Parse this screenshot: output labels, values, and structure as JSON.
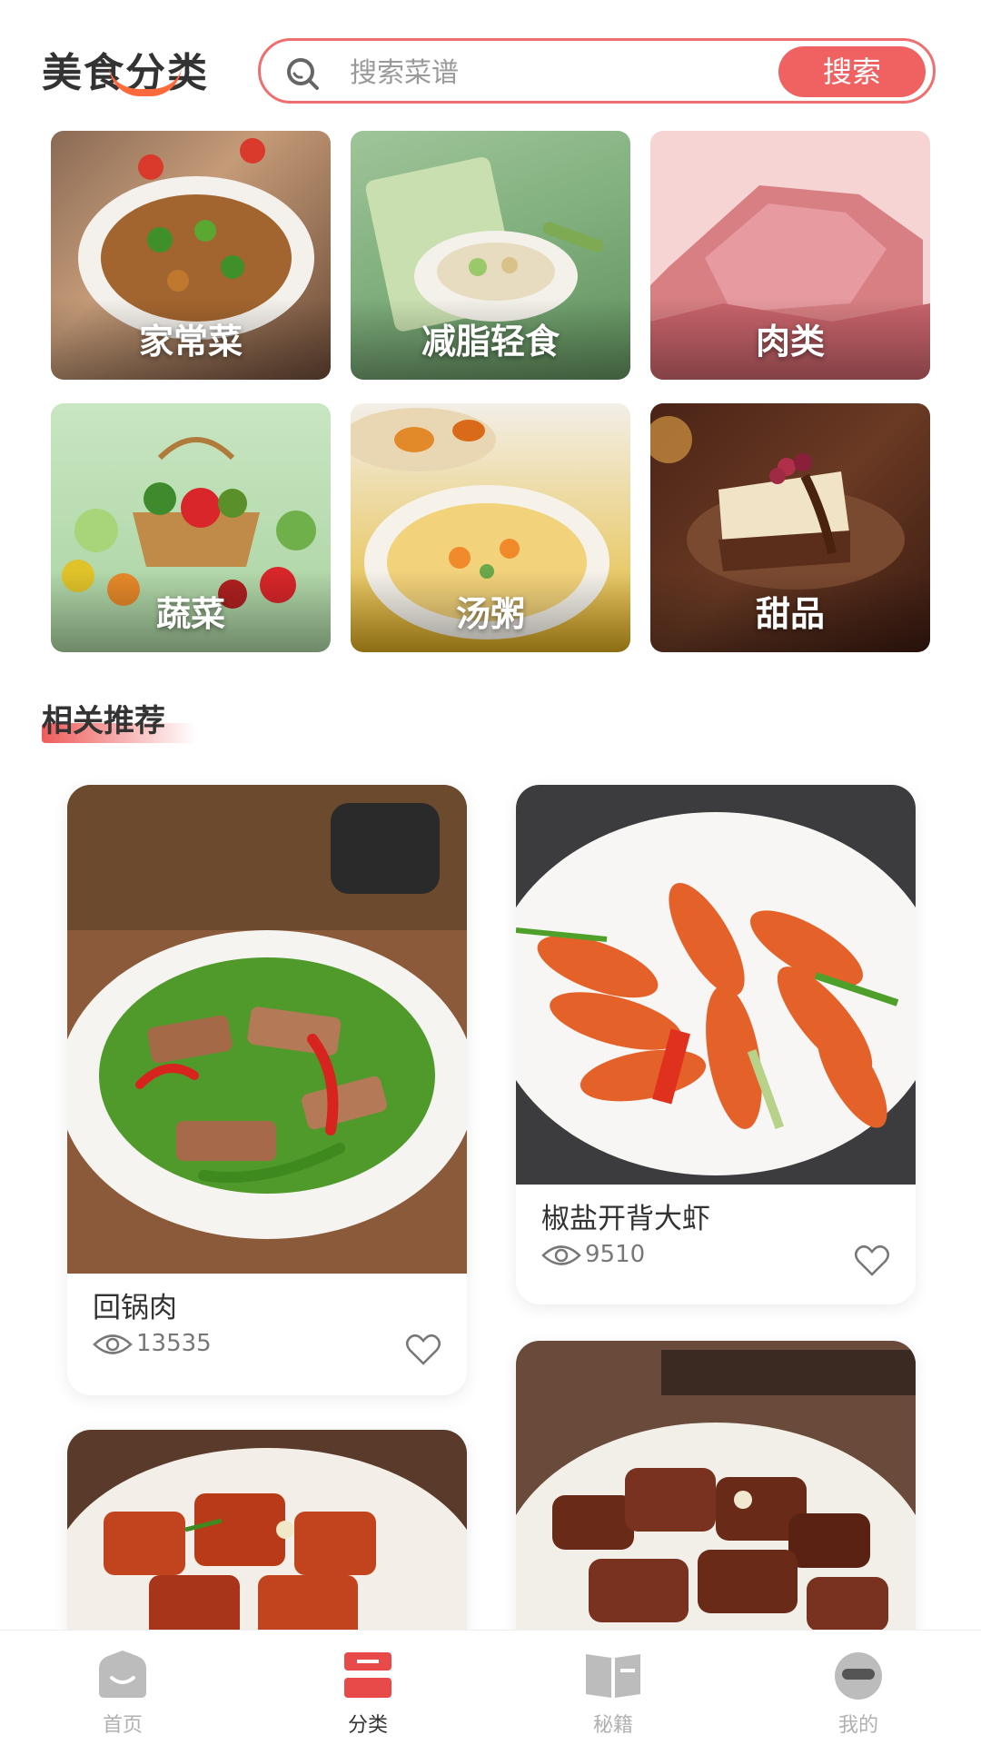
{
  "header": {
    "title": "美食分类",
    "search_placeholder": "搜索菜谱",
    "search_button": "搜索"
  },
  "categories": [
    {
      "label": "家常菜"
    },
    {
      "label": "减脂轻食"
    },
    {
      "label": "肉类"
    },
    {
      "label": "蔬菜"
    },
    {
      "label": "汤粥"
    },
    {
      "label": "甜品"
    }
  ],
  "section": {
    "title": "相关推荐"
  },
  "recipes": [
    {
      "name": "回锅肉",
      "views": "13535"
    },
    {
      "name": "椒盐开背大虾",
      "views": "9510"
    }
  ],
  "nav": [
    {
      "label": "首页",
      "icon": "home-icon"
    },
    {
      "label": "分类",
      "icon": "category-icon"
    },
    {
      "label": "秘籍",
      "icon": "book-icon"
    },
    {
      "label": "我的",
      "icon": "profile-icon"
    }
  ],
  "colors": {
    "accent": "#f06262",
    "inactive": "#b0b0b0"
  }
}
